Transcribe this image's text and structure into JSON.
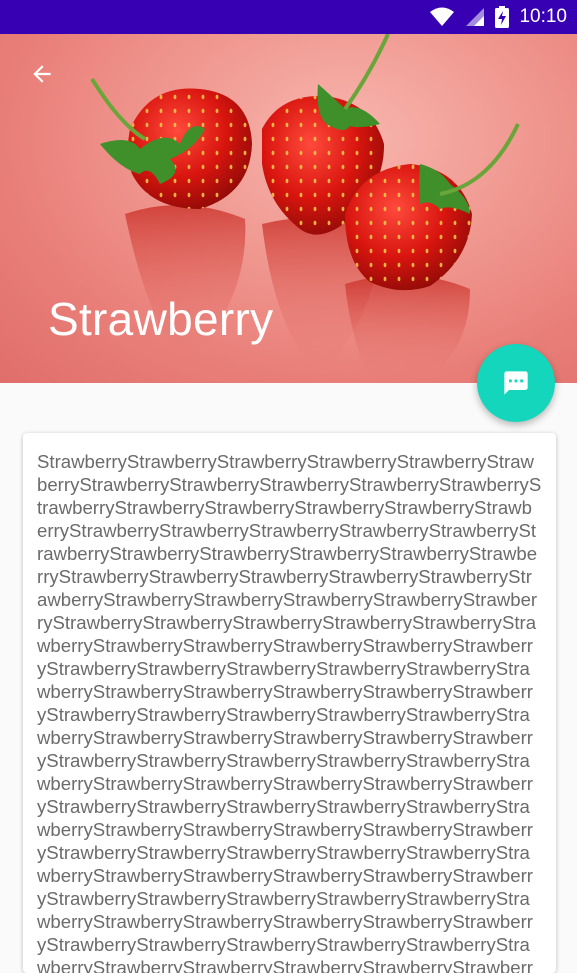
{
  "status_bar": {
    "time": "10:10",
    "icons": [
      "wifi-icon",
      "signal-icon",
      "battery-charging-icon"
    ]
  },
  "toolbar": {
    "back_icon": "arrow-back-icon",
    "title": "Strawberry"
  },
  "header_image": {
    "subject": "strawberries",
    "background_color": "#f09a92"
  },
  "fab": {
    "icon": "chat-icon",
    "color": "#14d6bc"
  },
  "content": {
    "text": "StrawberryStrawberryStrawberryStrawberryStrawberryStrawberryStrawberryStrawberryStrawberryStrawberryStrawberryStrawberryStrawberryStrawberryStrawberryStrawberryStrawberryStrawberryStrawberryStrawberryStrawberryStrawberryStrawberryStrawberryStrawberryStrawberryStrawberryStrawberryStrawberryStrawberryStrawberryStrawberryStrawberryStrawberryStrawberryStrawberryStrawberryStrawberryStrawberryStrawberryStrawberryStrawberryStrawberryStrawberryStrawberryStrawberryStrawberryStrawberryStrawberryStrawberryStrawberryStrawberryStrawberryStrawberryStrawberryStrawberryStrawberryStrawberryStrawberryStrawberryStrawberryStrawberryStrawberryStrawberryStrawberryStrawberryStrawberryStrawberryStrawberryStrawberryStrawberryStrawberryStrawberryStrawberryStrawberryStrawberryStrawberryStrawberryStrawberryStrawberryStrawberryStrawberryStrawberryStrawberryStrawberryStrawberryStrawberryStrawberryStrawberryStrawberryStrawberryStrawberryStrawberryStrawberryStrawberryStrawberryStrawberryStrawberryStrawberryStrawberryStrawberryStrawberryStrawberryStrawberryStrawberryStrawberryStrawberryStrawberryStrawberryStrawberryStrawberryStrawberryStrawberryStrawberryStrawberryStrawberryStrawberryStrawberryStrawberryStrawberryStrawberryStrawberryStrawberryStrawberryStrawberryStrawberryStrawberryStrawberryStrawberryStrawberryStrawberryStrawberry"
  },
  "colors": {
    "status_bar": "#3700b3",
    "text": "#6b6b6b",
    "background": "#fafafa"
  }
}
